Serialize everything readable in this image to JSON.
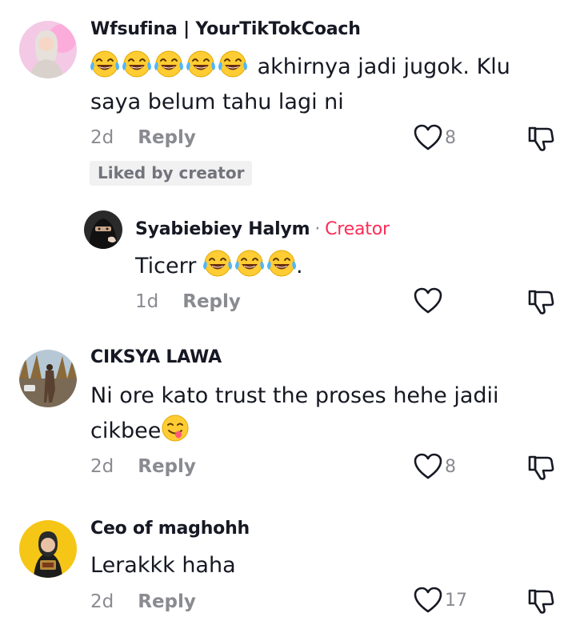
{
  "comments": [
    {
      "username": "Wfsufina | YourTikTokCoach",
      "text_emoji": "laughing-tears-emoji x5",
      "text": "akhirnya jadi jugok. Klu",
      "text_line2": "saya belum tahu lagi ni",
      "time": "2d",
      "reply_label": "Reply",
      "like_count": "8",
      "badge": "Liked by creator"
    },
    {
      "username": "Syabiebiey Halym",
      "separator": "·",
      "creator_label": "Creator",
      "text": "Ticerr",
      "text_suffix": ".",
      "time": "1d",
      "reply_label": "Reply"
    },
    {
      "username": "CIKSYA LAWA",
      "text": "Ni ore kato trust the proses hehe jadii",
      "text_line2": "cikbee",
      "time": "2d",
      "reply_label": "Reply",
      "like_count": "8"
    },
    {
      "username": "Ceo of maghohh",
      "text": "Lerakkk haha",
      "time": "2d",
      "reply_label": "Reply",
      "like_count": "17"
    }
  ],
  "icons": {
    "like": "heart-outline-icon",
    "dislike": "thumbs-down-icon",
    "emoji_1": "face-with-tears-of-joy",
    "emoji_2": "face-savoring-food"
  },
  "colors": {
    "text": "#161823",
    "muted": "#8a8b91",
    "creator": "#fe2c55",
    "badge_bg": "#f1f1f2"
  }
}
